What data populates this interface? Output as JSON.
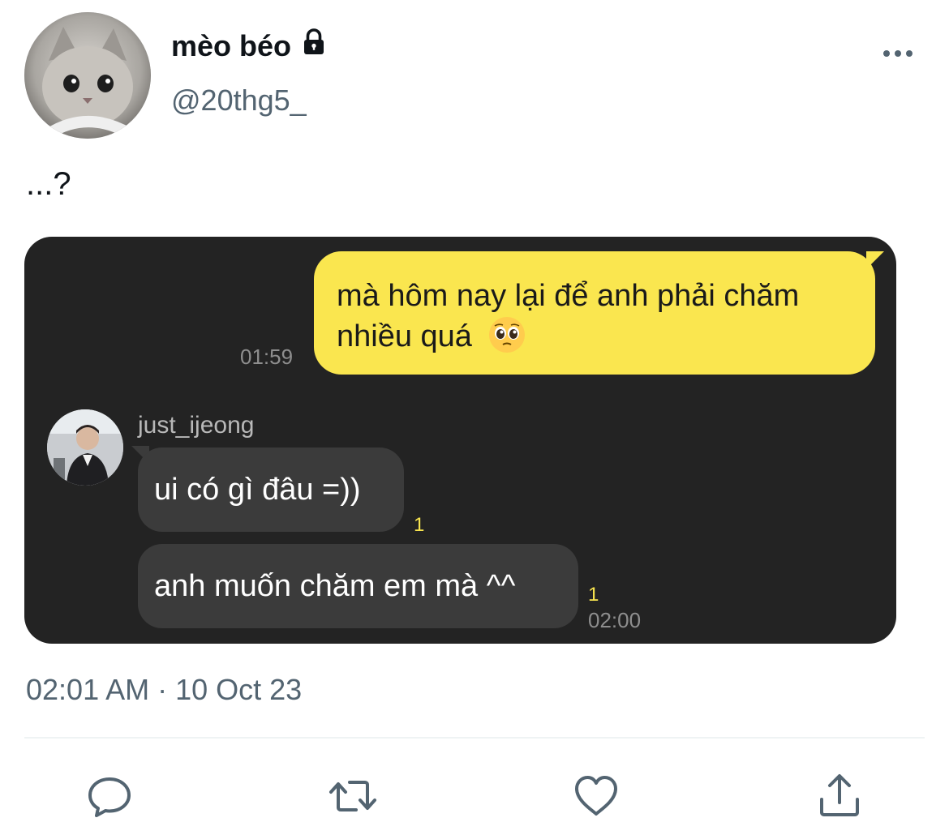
{
  "user": {
    "display_name": "mèo béo",
    "handle": "@20thg5_",
    "avatar_icon": "kitten-avatar",
    "verified_icon": "lock-icon"
  },
  "tweet": {
    "text": "...?",
    "timestamp": "02:01 AM · 10 Oct 23"
  },
  "chat": {
    "outgoing": {
      "text": "mà hôm nay lại để anh phải chăm nhiều quá",
      "emoji": "pleading-face-emoji",
      "time": "01:59",
      "bubble_color": "#fae64f"
    },
    "contact": {
      "name": "just_ijeong",
      "avatar_icon": "person-avatar"
    },
    "incoming": [
      {
        "text": "ui có gì đâu =))",
        "unread": "1"
      },
      {
        "text": "anh muốn chăm em mà ^^",
        "unread": "1"
      }
    ],
    "incoming_time": "02:00",
    "background": "#232323"
  },
  "actions": [
    "reply-icon",
    "retweet-icon",
    "like-icon",
    "share-icon"
  ],
  "colors": {
    "secondary_text": "#536471",
    "unread_badge": "#fae64f"
  }
}
